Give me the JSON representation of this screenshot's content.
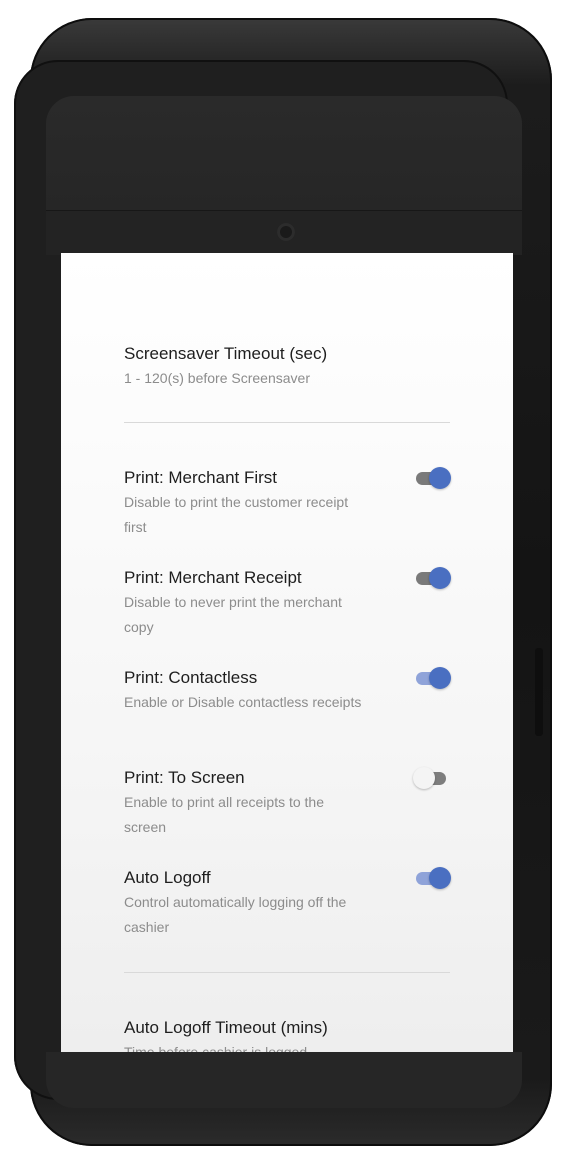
{
  "colors": {
    "toggle_on_knob": "#4a6fc1",
    "toggle_on_track_dark": "#7a7a7a",
    "toggle_on_track_light": "#8fa3d9",
    "toggle_off_knob": "#f4f4f4",
    "toggle_off_track": "#7d7d7d"
  },
  "settings": {
    "screensaver": {
      "title": "Screensaver Timeout (sec)",
      "description": "1 - 120(s) before Screensaver"
    },
    "toggles": [
      {
        "title": "Print: Merchant First",
        "description": "Disable to print the customer receipt first",
        "enabled": true
      },
      {
        "title": "Print: Merchant Receipt",
        "description": "Disable to never print the merchant copy",
        "enabled": true
      },
      {
        "title": "Print: Contactless",
        "description": "Enable or Disable contactless receipts",
        "enabled": true
      },
      {
        "title": "Print: To Screen",
        "description": "Enable to print all receipts to the screen",
        "enabled": false
      },
      {
        "title": "Auto Logoff",
        "description": "Control automatically logging off the cashier",
        "enabled": true
      }
    ],
    "logoff_timeout": {
      "title": "Auto Logoff Timeout (mins)",
      "description": "Time before cashier is logged"
    }
  }
}
